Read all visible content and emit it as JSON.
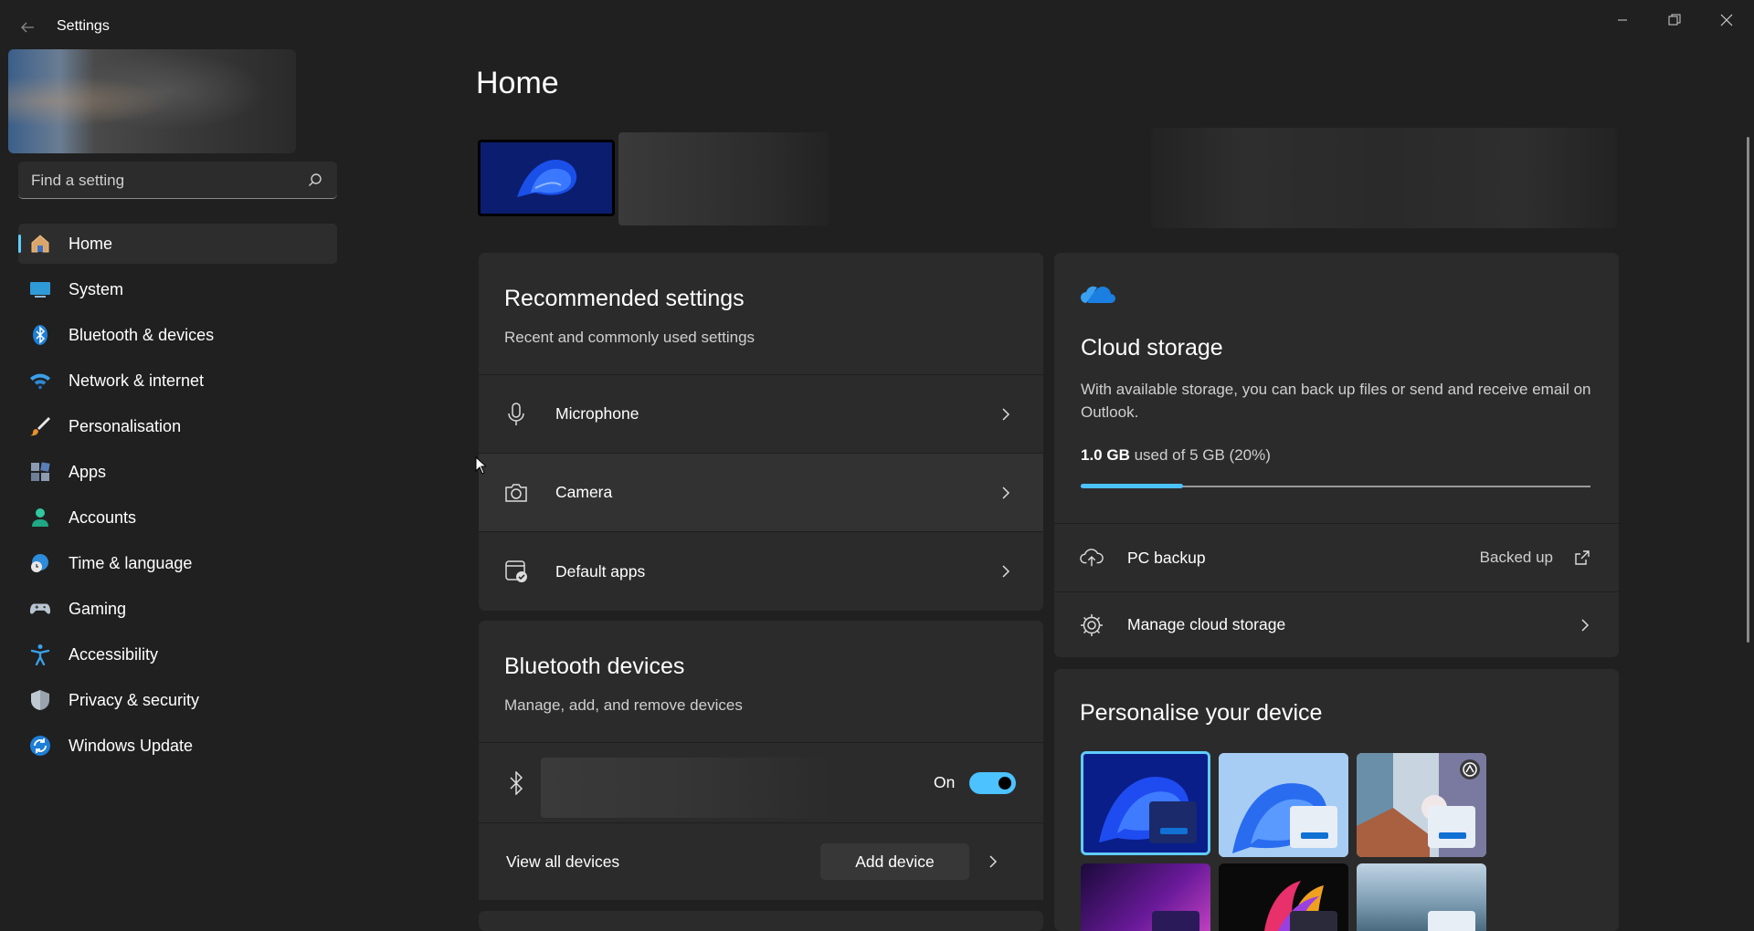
{
  "window": {
    "title": "Settings"
  },
  "search": {
    "placeholder": "Find a setting"
  },
  "sidebar": {
    "items": [
      {
        "label": "Home",
        "icon": "home-icon",
        "active": true
      },
      {
        "label": "System",
        "icon": "system-icon"
      },
      {
        "label": "Bluetooth & devices",
        "icon": "bluetooth-icon"
      },
      {
        "label": "Network & internet",
        "icon": "wifi-icon"
      },
      {
        "label": "Personalisation",
        "icon": "brush-icon"
      },
      {
        "label": "Apps",
        "icon": "apps-icon"
      },
      {
        "label": "Accounts",
        "icon": "accounts-icon"
      },
      {
        "label": "Time & language",
        "icon": "time-language-icon"
      },
      {
        "label": "Gaming",
        "icon": "gamepad-icon"
      },
      {
        "label": "Accessibility",
        "icon": "accessibility-icon"
      },
      {
        "label": "Privacy & security",
        "icon": "shield-icon"
      },
      {
        "label": "Windows Update",
        "icon": "update-icon"
      }
    ]
  },
  "main": {
    "title": "Home",
    "recommended": {
      "title": "Recommended settings",
      "subtitle": "Recent and commonly used settings",
      "rows": [
        {
          "label": "Microphone",
          "icon": "microphone-icon"
        },
        {
          "label": "Camera",
          "icon": "camera-icon"
        },
        {
          "label": "Default apps",
          "icon": "default-apps-icon"
        }
      ]
    },
    "bluetooth": {
      "title": "Bluetooth devices",
      "subtitle": "Manage, add, and remove devices",
      "toggle_label": "On",
      "view_all": "View all devices",
      "add_device": "Add device"
    },
    "cloud": {
      "title": "Cloud storage",
      "description": "With available storage, you can back up files or send and receive email on Outlook.",
      "used_amount": "1.0 GB",
      "used_text": "used of 5 GB (20%)",
      "used_fraction": 0.2,
      "accent_color": "#4cc2ff",
      "pc_backup_label": "PC backup",
      "pc_backup_status": "Backed up",
      "manage_label": "Manage cloud storage"
    },
    "personalise": {
      "title": "Personalise your device"
    }
  }
}
